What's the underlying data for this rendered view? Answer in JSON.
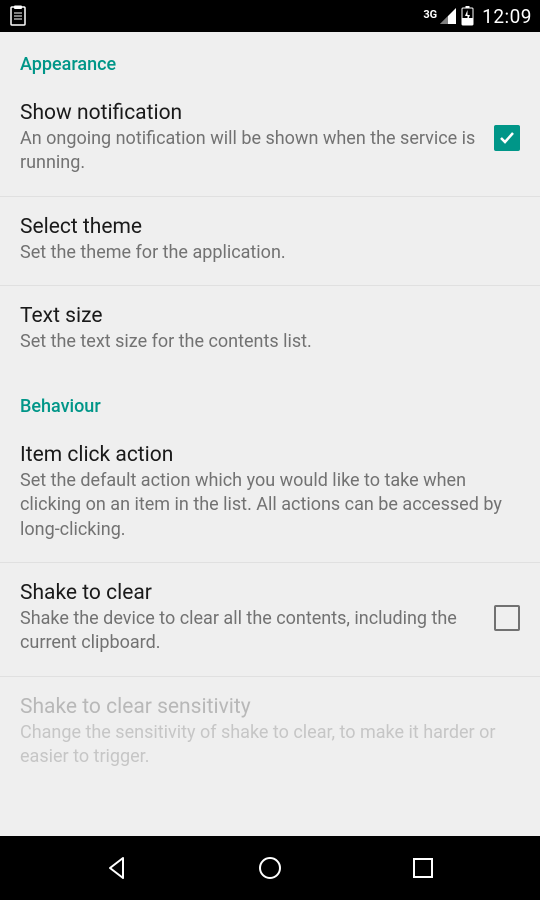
{
  "statusbar": {
    "network": "3G",
    "time": "12:09"
  },
  "sections": {
    "appearance": {
      "header": "Appearance",
      "show_notification": {
        "title": "Show notification",
        "desc": "An ongoing notification will be shown when the service is running."
      },
      "select_theme": {
        "title": "Select theme",
        "desc": "Set the theme for the application."
      },
      "text_size": {
        "title": "Text size",
        "desc": "Set the text size for the contents list."
      }
    },
    "behaviour": {
      "header": "Behaviour",
      "item_click": {
        "title": "Item click action",
        "desc": "Set the default action which you would like to take when clicking on an item in the list. All actions can be accessed by long-clicking."
      },
      "shake_clear": {
        "title": "Shake to clear",
        "desc": "Shake the device to clear all the contents, including the current clipboard."
      },
      "shake_sensitivity": {
        "title": "Shake to clear sensitivity",
        "desc": "Change the sensitivity of shake to clear, to make it harder or easier to trigger."
      }
    }
  },
  "colors": {
    "accent": "#009688",
    "bg": "#efefef",
    "text_primary": "#1a1a1a",
    "text_secondary": "#727272"
  }
}
